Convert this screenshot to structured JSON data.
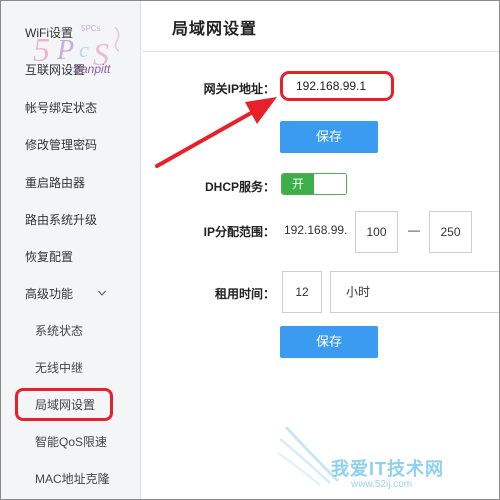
{
  "sidebar": {
    "items": [
      {
        "label": "WiFi设置"
      },
      {
        "label": "互联网设置"
      },
      {
        "label": "帐号绑定状态"
      },
      {
        "label": "修改管理密码"
      },
      {
        "label": "重启路由器"
      },
      {
        "label": "路由系统升级"
      },
      {
        "label": "恢复配置"
      },
      {
        "label": "高级功能"
      },
      {
        "label": "系统状态"
      },
      {
        "label": "无线中继"
      },
      {
        "label": "局域网设置"
      },
      {
        "label": "智能QoS限速"
      },
      {
        "label": "MAC地址克隆"
      }
    ],
    "active_item": "局域网设置"
  },
  "watermark_logo": {
    "text": "Sanpitt",
    "brand": "5PCs"
  },
  "page": {
    "title": "局域网设置"
  },
  "form": {
    "gateway_ip_label": "网关IP地址：",
    "gateway_ip_value": "192.168.99.1",
    "save_label_1": "保存",
    "dhcp_label": "DHCP服务：",
    "dhcp_toggle_label": "开",
    "ip_range_label": "IP分配范围：",
    "ip_range_prefix": "192.168.99.",
    "ip_range_start": "100",
    "ip_range_sep": "—",
    "ip_range_end": "250",
    "lease_label": "租用时间：",
    "lease_value": "12",
    "lease_unit": "小时",
    "save_label_2": "保存"
  },
  "watermark": {
    "text": "我爱IT技术网",
    "url": "www.52ij.com"
  },
  "colors": {
    "accent": "#3b9bf0",
    "highlight": "#e8202a",
    "toggle_on": "#3dae4a"
  }
}
